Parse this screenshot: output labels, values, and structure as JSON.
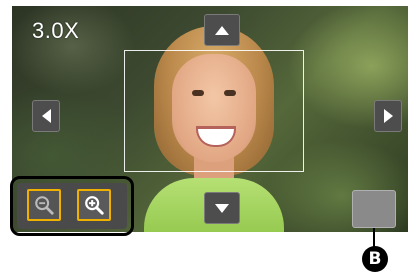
{
  "zoom_readout": "3.0X",
  "callout_label": "B",
  "colors": {
    "zoom_button_border": "#f0b000",
    "button_bg": "#4d4d4d",
    "panel_border": "#000000"
  },
  "icons": {
    "up": "arrow-up-icon",
    "down": "arrow-down-icon",
    "left": "arrow-left-icon",
    "right": "arrow-right-icon",
    "zoom_out": "zoom-out-icon",
    "zoom_in": "zoom-in-icon"
  }
}
